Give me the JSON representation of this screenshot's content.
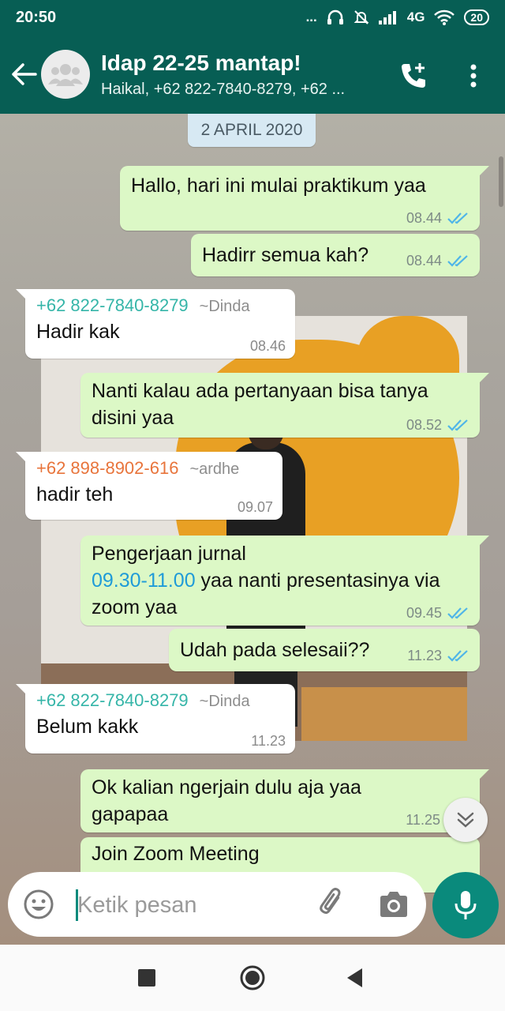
{
  "status_bar": {
    "time": "20:50",
    "dots": "...",
    "network": "4G",
    "battery": "20"
  },
  "header": {
    "group_name": "Idap 22-25 mantap!",
    "members": "Haikal, +62 822-7840-8279, +62 ..."
  },
  "chat": {
    "date": "2 APRIL 2020",
    "messages": [
      {
        "text": "Hallo, hari ini mulai praktikum yaa",
        "time": "08.44"
      },
      {
        "text": "Hadirr semua kah?",
        "time": "08.44"
      },
      {
        "sender": "+62 822-7840-8279",
        "alias": "~Dinda",
        "text": "Hadir kak",
        "time": "08.46"
      },
      {
        "text": "Nanti kalau ada pertanyaan bisa tanya disini yaa",
        "time": "08.52"
      },
      {
        "sender": "+62 898-8902-616",
        "alias": "~ardhe",
        "text": "hadir teh",
        "time": "09.07"
      },
      {
        "text_line1": "Pengerjaan jurnal",
        "link": "09.30-11.00",
        "text_rest": " yaa nanti presentasinya via zoom yaa",
        "time": "09.45"
      },
      {
        "text": "Udah pada selesaii??",
        "time": "11.23"
      },
      {
        "sender": "+62 822-7840-8279",
        "alias": "~Dinda",
        "text": "Belum kakk",
        "time": "11.23"
      },
      {
        "text": "Ok kalian ngerjain dulu aja yaa gapapaa",
        "time": "11.25"
      },
      {
        "text": "Join Zoom Meeting"
      }
    ]
  },
  "composer": {
    "placeholder": "Ketik pesan"
  },
  "colors": {
    "header": "#075e54",
    "outgoing": "#dcf8c6",
    "incoming": "#ffffff",
    "sender_teal": "#35b5a8",
    "sender_orange": "#e8743b",
    "link": "#1f9bd8",
    "mic": "#0a8a7c"
  },
  "icons": [
    "back-arrow-icon",
    "group-avatar-icon",
    "add-call-icon",
    "more-vert-icon",
    "double-check-icon",
    "chevron-down-icon",
    "emoji-icon",
    "paperclip-icon",
    "camera-icon",
    "mic-icon",
    "nav-recents-icon",
    "nav-home-icon",
    "nav-back-icon"
  ]
}
